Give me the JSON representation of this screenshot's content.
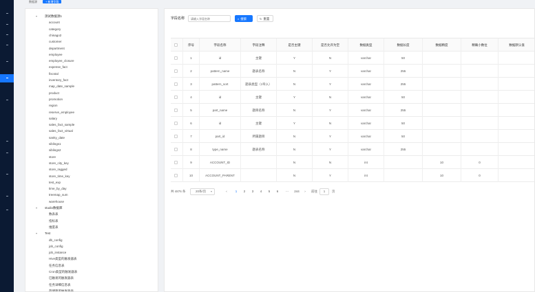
{
  "sidebar": {
    "items": [
      {
        "id": "s1",
        "active": false
      },
      {
        "id": "s2",
        "active": false
      },
      {
        "id": "s3",
        "active": false
      },
      {
        "id": "s4",
        "active": false
      },
      {
        "id": "s5",
        "active": false
      },
      {
        "id": "s6",
        "active": true
      },
      {
        "id": "s7",
        "active": false
      },
      {
        "id": "s8",
        "active": false
      },
      {
        "id": "s9",
        "active": false
      },
      {
        "id": "s10",
        "active": false
      },
      {
        "id": "s11",
        "active": false
      },
      {
        "id": "s12",
        "active": false
      }
    ]
  },
  "topbar": {
    "tab1": "数据源",
    "tab2": "+ 新增字段"
  },
  "tree": {
    "groups": [
      {
        "label": "测试数据源1",
        "children": [
          "account",
          "category",
          "chinago2",
          "customer",
          "department",
          "employee",
          "employee_closure",
          "expense_fact",
          "fiscstal",
          "inventory_fact",
          "map_date_sample",
          "product",
          "promotion",
          "region",
          "reserve_employee",
          "salary",
          "sales_fact_sample",
          "sales_fact_virtual",
          "sanky_date",
          "siblings1",
          "siblings2",
          "store",
          "store_city_key",
          "store_ragged",
          "store_time_key",
          "test_exp",
          "time_by_day",
          "treemap_sum",
          "warehouse"
        ]
      },
      {
        "label": "studio数据库",
        "children": [
          "数表表",
          "指标表",
          "维度表"
        ]
      },
      {
        "label": "Test",
        "children": [
          "db_config",
          "job_config",
          "job_instance",
          "Hive类型的触发器表",
          "任务信息表",
          "Cron类型的触发器表",
          "已触发的触发器表",
          "任务详细信息表",
          "存储简单触发器表"
        ]
      }
    ]
  },
  "filter": {
    "label": "字段名称",
    "placeholder": "请输入字段名称",
    "search_label": "搜索",
    "reset_label": "重置"
  },
  "table": {
    "headers": [
      "序号",
      "字段名称",
      "字段注释",
      "是否主键",
      "是否允许为空",
      "数据类型",
      "数据长度",
      "数据精度",
      "精确小数位",
      "数据默认值"
    ],
    "rows": [
      [
        "1",
        "id",
        "主键",
        "Y",
        "N",
        "varchar",
        "50",
        "",
        "",
        ""
      ],
      [
        "2",
        "pattern_name",
        "题表名称",
        "N",
        "Y",
        "varchar",
        "255",
        "",
        "",
        ""
      ],
      [
        "3",
        "pattern_sort",
        "题表类型（1导入）",
        "N",
        "Y",
        "varchar",
        "255",
        "",
        "",
        ""
      ],
      [
        "4",
        "id",
        "主键",
        "Y",
        "N",
        "varchar",
        "50",
        "",
        "",
        ""
      ],
      [
        "5",
        "part_name",
        "题目名称",
        "N",
        "Y",
        "varchar",
        "255",
        "",
        "",
        ""
      ],
      [
        "6",
        "id",
        "主键",
        "Y",
        "N",
        "varchar",
        "50",
        "",
        "",
        ""
      ],
      [
        "7",
        "part_id",
        "所属题目",
        "N",
        "Y",
        "varchar",
        "50",
        "",
        "",
        ""
      ],
      [
        "8",
        "type_name",
        "题表名称",
        "N",
        "Y",
        "varchar",
        "255",
        "",
        "",
        ""
      ],
      [
        "9",
        "ACCOUNT_ID",
        "",
        "N",
        "N",
        "int",
        "",
        "10",
        "0",
        ""
      ],
      [
        "10",
        "ACCOUNT_PARENT",
        "",
        "N",
        "Y",
        "int",
        "",
        "10",
        "0",
        ""
      ]
    ]
  },
  "pager": {
    "total": "共 4876 条",
    "size": "20条/页",
    "pages": [
      "1",
      "2",
      "3",
      "4",
      "5",
      "6",
      "···",
      "244"
    ],
    "prev": "‹",
    "next": "›",
    "jump_prefix": "前往",
    "jump_value": "1",
    "jump_suffix": "页"
  }
}
